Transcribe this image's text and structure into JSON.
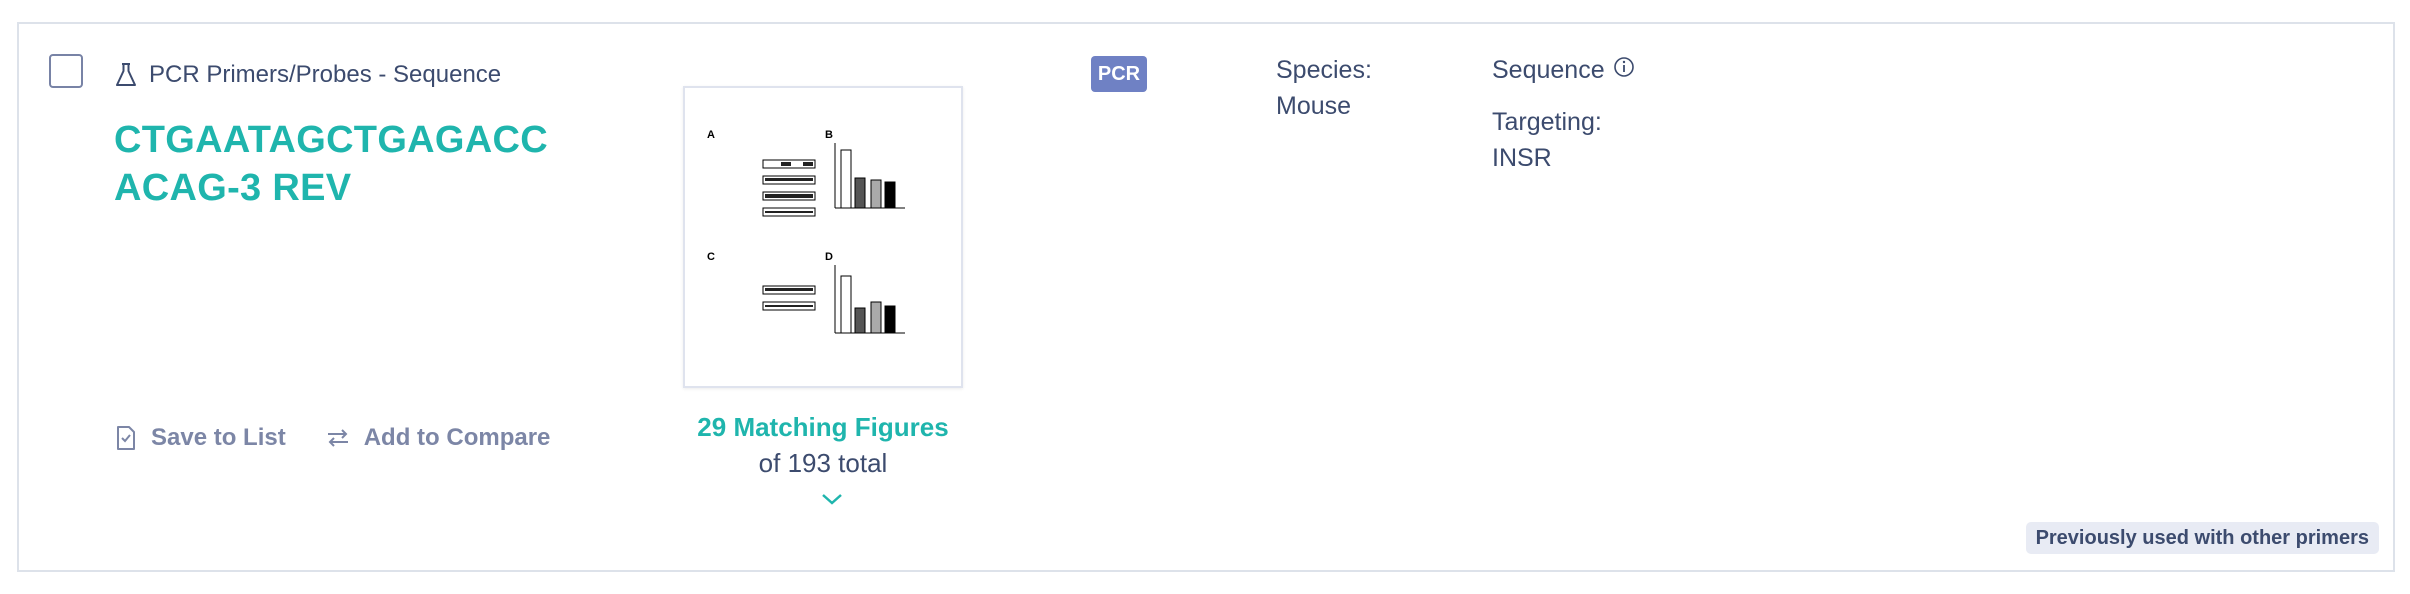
{
  "result": {
    "type_label": "PCR Primers/Probes - Sequence",
    "title": "CTGAATAGCTGAGACCACAG-3 REV",
    "badge": "PCR",
    "species_label": "Species:",
    "species_value": "Mouse",
    "sequence_label": "Sequence",
    "targeting_label": "Targeting:",
    "targeting_value": "INSR",
    "actions": {
      "save_label": "Save to List",
      "compare_label": "Add to Compare"
    },
    "figures": {
      "matching": "29 Matching Figures",
      "total": "of 193 total"
    },
    "previous_badge": "Previously used with other primers"
  },
  "colors": {
    "accent": "#1fb5ad",
    "text": "#3c4b6e",
    "badge": "#6f81c4",
    "muted": "#7c86a6"
  },
  "icons": {
    "type": "flask-icon",
    "save": "save-list-icon",
    "compare": "compare-arrows-icon",
    "info": "info-icon",
    "expand": "chevron-down-icon"
  }
}
